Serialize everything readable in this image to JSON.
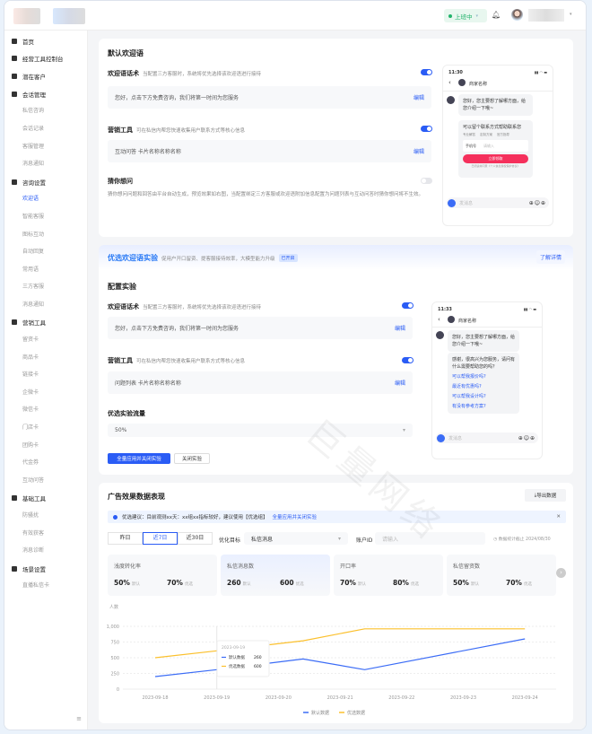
{
  "header": {
    "status": "上班中",
    "status_color": "#21b36b"
  },
  "sidebar": {
    "groups": [
      {
        "label": "首页",
        "subs": []
      },
      {
        "label": "经营工具控制台",
        "subs": []
      },
      {
        "label": "潜在客户",
        "subs": []
      },
      {
        "label": "会话管理",
        "subs": [
          "私信咨询",
          "会话记录",
          "客服管理",
          "消息通知"
        ]
      },
      {
        "label": "咨询设置",
        "subs": [
          "欢迎语",
          "智能客服",
          "图标互动",
          "自动回复",
          "常用语",
          "三方客服",
          "消息通知"
        ]
      },
      {
        "label": "营销工具",
        "subs": [
          "留资卡",
          "商品卡",
          "链接卡",
          "企微卡",
          "微信卡",
          "门店卡",
          "团购卡",
          "代金券",
          "互动问答"
        ]
      },
      {
        "label": "基础工具",
        "subs": [
          "防骚扰",
          "有效获客",
          "消息诊断"
        ]
      },
      {
        "label": "场景设置",
        "subs": [
          "直播私信卡"
        ]
      }
    ],
    "active": "欢迎语"
  },
  "default_welcome": {
    "title": "默认欢迎语",
    "script": {
      "label": "欢迎语话术",
      "desc": "当配置三方客服时，系统将优先选择该欢迎语进行接待",
      "content": "您好，点击下方免费咨询，我们将第一时间为您服务",
      "edit": "编辑",
      "enabled": true
    },
    "tool": {
      "label": "营销工具",
      "desc": "可在私信内帮您快速收集用户联系方式等核心信息",
      "content": "互动问答  卡片名称名称名称",
      "edit": "编辑",
      "enabled": true
    },
    "guess": {
      "label": "猜你想问",
      "enabled": false,
      "desc": "猜你想问问题和回答由平台自动生成，预览效果如右图，当配置绑定三方客服或欢迎语附加信息配置为问题列表与互动问答时猜你想问将不生效。"
    }
  },
  "phone1": {
    "time": "11:30",
    "name": "商家名称",
    "msg": "您好，您主要想了解哪方面，给您介绍一下哦~",
    "form_title": "可以留个联系方式帮助联系您",
    "tags": [
      "专业解答",
      "定制方案",
      "官方指导"
    ],
    "field_label": "手机号",
    "field_placeholder": "请输入",
    "submit": "立即领取",
    "footer": "已阅读并同意《个人信息授权保护协议》",
    "input_placeholder": "发消息"
  },
  "experiment": {
    "title": "优选欢迎语实验",
    "desc": "促用户开口留资、提客服接待效率，大模型能力升级",
    "badge": "已开启",
    "detail": "了解详情",
    "config_title": "配置实验",
    "script": {
      "label": "欢迎语话术",
      "desc": "当配置三方客服时，系统将优先选择该欢迎语进行接待",
      "content": "您好，点击下方免费咨询，我们将第一时间为您服务",
      "edit": "编辑"
    },
    "tool": {
      "label": "营销工具",
      "desc": "可在私信内帮您快速收集用户联系方式等核心信息",
      "content": "问题列表  卡片名称名称名称",
      "edit": "编辑"
    },
    "traffic_label": "优选实验流量",
    "traffic_value": "50%",
    "apply_btn": "全量应用并关闭实验",
    "close_btn": "关闭实验"
  },
  "phone2": {
    "time": "11:33",
    "name": "商家名称",
    "msg": "您好，您主要想了解哪方面，给您介绍一下哦~",
    "msg2": "感谢，很高兴为您服务，请问有什么需要帮助您的吗？",
    "questions": [
      "可以帮我报价吗?",
      "最近有优惠吗?",
      "可以帮我设计吗?",
      "有没有参考方案?"
    ],
    "input_placeholder": "发消息"
  },
  "ads": {
    "title": "广告效果数据表现",
    "export": "导出数据",
    "notice": {
      "text": "优选建议：目前观测xx天：xx组xx指标较好，建议使用【优选组】",
      "link": "全量应用并关闭实验"
    },
    "ranges": [
      "昨日",
      "近7日",
      "近30日"
    ],
    "active_range": "近7日",
    "goal_label": "优化目标",
    "goal_value": "私信消息",
    "account_label": "账户ID",
    "account_placeholder": "请输入",
    "deadline": "数据统计截止 2024/08/30",
    "metrics": [
      {
        "title": "浅度转化率",
        "a": "50%",
        "a_tag": "默认",
        "b": "70%",
        "b_tag": "优选"
      },
      {
        "title": "私信消息数",
        "a": "260",
        "a_tag": "默认",
        "b": "600",
        "b_tag": "优选"
      },
      {
        "title": "开口率",
        "a": "70%",
        "a_tag": "默认",
        "b": "80%",
        "b_tag": "优选"
      },
      {
        "title": "私信留资数",
        "a": "50%",
        "a_tag": "默认",
        "b": "70%",
        "b_tag": "优选"
      }
    ]
  },
  "chart_data": {
    "type": "line",
    "ylabel": "人数",
    "ylim": [
      0,
      1000
    ],
    "yticks": [
      "0",
      "250",
      "500",
      "750",
      "1,000"
    ],
    "categories": [
      "2023-09-18",
      "2023-09-19",
      "2023-09-20",
      "2023-09-21",
      "2023-09-22",
      "2023-09-23",
      "2023-09-24"
    ],
    "series": [
      {
        "name": "默认数据",
        "color": "#3b6cf6",
        "points": [
          [
            0,
            200
          ],
          [
            1,
            310
          ],
          [
            2.4,
            480
          ],
          [
            3.4,
            310
          ],
          [
            6,
            800
          ]
        ]
      },
      {
        "name": "优选数据",
        "color": "#fbc02d",
        "points": [
          [
            0,
            500
          ],
          [
            1,
            610
          ],
          [
            2.4,
            770
          ],
          [
            3.4,
            960
          ],
          [
            6,
            960
          ]
        ]
      }
    ],
    "legend": "bottom",
    "tooltip": {
      "date": "2023-09-19",
      "rows": [
        {
          "name": "默认数据",
          "value": "260"
        },
        {
          "name": "优选数据",
          "value": "600"
        }
      ]
    }
  },
  "watermark": "巨量网络"
}
